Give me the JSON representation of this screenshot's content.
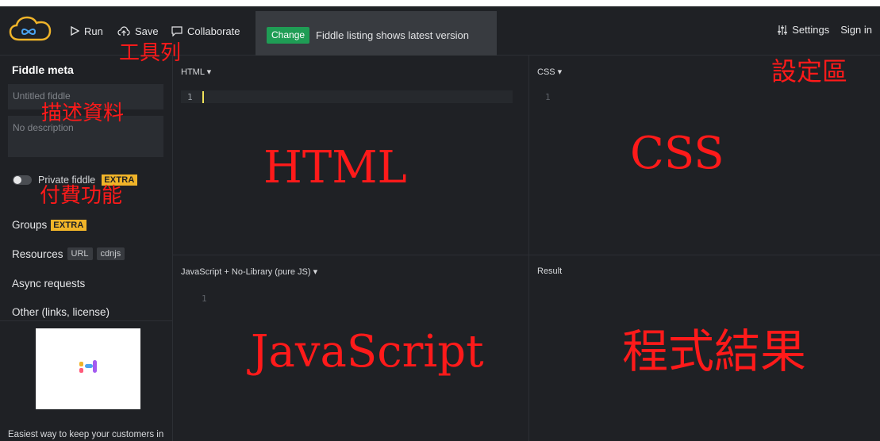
{
  "toolbar": {
    "run_label": "Run",
    "save_label": "Save",
    "collaborate_label": "Collaborate",
    "settings_label": "Settings",
    "signin_label": "Sign in"
  },
  "notice": {
    "button_label": "Change",
    "text": "Fiddle listing shows latest version"
  },
  "sidebar": {
    "title": "Fiddle meta",
    "name_placeholder": "Untitled fiddle",
    "description_placeholder": "No description",
    "private_label": "Private fiddle",
    "extra_badge": "EXTRA",
    "groups_label": "Groups",
    "resources_label": "Resources",
    "resource_tags": [
      "URL",
      "cdnjs"
    ],
    "async_label": "Async requests",
    "other_label": "Other (links, license)",
    "ad_text": "Easiest way to keep your customers in the loop about your product"
  },
  "panels": {
    "html_label": "HTML ▾",
    "css_label": "CSS ▾",
    "js_label": "JavaScript + No-Library (pure JS) ▾",
    "result_label": "Result",
    "line_number": "1"
  },
  "annotations": {
    "toolbar": "工具列",
    "settings": "設定區",
    "metadata": "描述資料",
    "paid": "付費功能",
    "html": "HTML",
    "css": "CSS",
    "javascript": "JavaScript",
    "result": "程式結果"
  },
  "colors": {
    "background": "#1f2125",
    "accent_green": "#1f9d55",
    "badge_yellow": "#f0b429",
    "annotation_red": "#ff1a1a"
  }
}
